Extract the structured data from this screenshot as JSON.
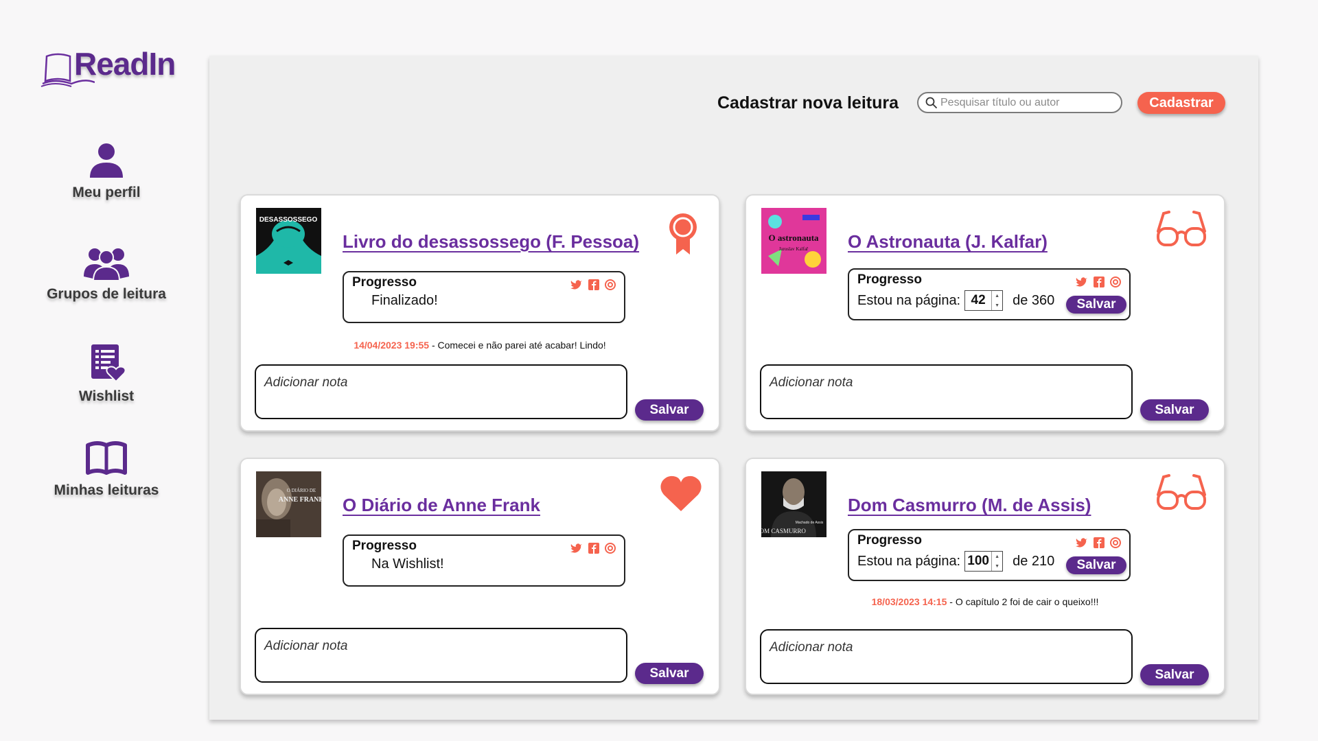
{
  "app": {
    "name": "ReadIn"
  },
  "colors": {
    "brand": "#5b2a8c",
    "accent": "#f5634e"
  },
  "sidebar": {
    "items": [
      {
        "label": "Meu perfil",
        "icon": "user-icon"
      },
      {
        "label": "Grupos de leitura",
        "icon": "group-icon"
      },
      {
        "label": "Wishlist",
        "icon": "wishlist-icon"
      },
      {
        "label": "Minhas leituras",
        "icon": "open-book-icon"
      }
    ]
  },
  "header": {
    "title": "Cadastrar nova leitura",
    "search_placeholder": "Pesquisar título ou autor",
    "register_label": "Cadastrar"
  },
  "cards": [
    {
      "title": "Livro do desassossego (F. Pessoa)",
      "status_icon": "award-ribbon-icon",
      "progress_label": "Progresso",
      "progress_status": "Finalizado!",
      "note_timestamp": "14/04/2023 19:55",
      "note_text": "- Comecei e não parei até acabar! Lindo!",
      "note_placeholder": "Adicionar nota",
      "save_label": "Salvar"
    },
    {
      "title": "O Astronauta (J. Kalfar)",
      "status_icon": "glasses-icon",
      "progress_label": "Progresso",
      "page_label": "Estou na página:",
      "current_page": "42",
      "total_pages": "de 360",
      "progress_save_label": "Salvar",
      "note_placeholder": "Adicionar nota",
      "save_label": "Salvar"
    },
    {
      "title": "O Diário de Anne Frank",
      "status_icon": "heart-icon",
      "progress_label": "Progresso",
      "progress_status": "Na Wishlist!",
      "note_placeholder": "Adicionar nota",
      "save_label": "Salvar"
    },
    {
      "title": "Dom Casmurro (M. de Assis)",
      "status_icon": "glasses-icon",
      "progress_label": "Progresso",
      "page_label": "Estou na página:",
      "current_page": "100",
      "total_pages": "de 210",
      "progress_save_label": "Salvar",
      "note_timestamp": "18/03/2023 14:15",
      "note_text": "- O capítulo 2 foi de cair o queixo!!!",
      "note_placeholder": "Adicionar nota",
      "save_label": "Salvar"
    }
  ],
  "covers": [
    {
      "text_top": "DESASSOSSEGO",
      "text_bottom": ""
    },
    {
      "text_top": "O astronauta",
      "text_bottom": "Jaroslav Kalfař"
    },
    {
      "text_top": "O DIÁRIO DE",
      "text_bottom": "ANNE FRANK"
    },
    {
      "text_top": "DOM CASMURRO",
      "text_bottom": "Machado de Assis"
    }
  ]
}
